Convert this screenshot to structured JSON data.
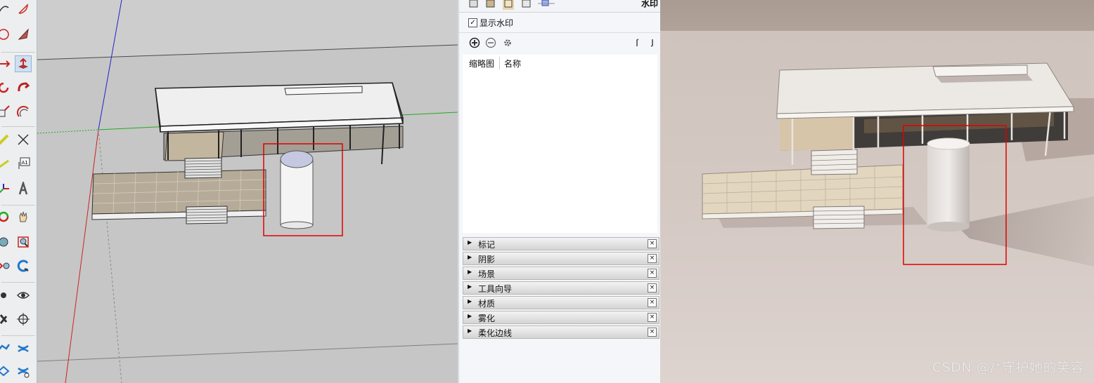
{
  "tray": {
    "title": "水印",
    "show_watermark_label": "显示水印",
    "show_watermark_checked": "☑",
    "list_headers": [
      "缩略图",
      "名称"
    ],
    "sections": [
      "标记",
      "阴影",
      "场景",
      "工具向导",
      "材质",
      "雾化",
      "柔化边线"
    ],
    "close_glyph": "×",
    "collapse_glyph": "▶"
  },
  "toolbar": {
    "text_tool_label": "A1"
  },
  "render": {
    "watermark": "CSDN @/*守护她的笑容"
  },
  "colors": {
    "highlight_box": "#e00000",
    "viewport_background": "#c9c9c9",
    "axis_blue": "#2222cc",
    "axis_green": "#22aa22",
    "axis_red": "#cc2222"
  }
}
